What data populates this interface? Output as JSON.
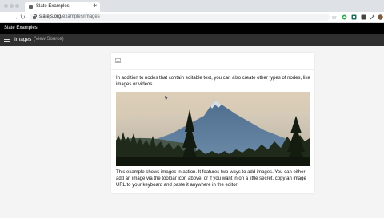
{
  "browser": {
    "tab_title": "Slate Examples",
    "tab_close": "×",
    "new_tab": "+",
    "url_host": "slatejs.org",
    "url_path": "/examples/images",
    "back": "←",
    "forward": "→",
    "reload": "↻",
    "bookmark_star": "☆",
    "extensions": [
      "extension-icon",
      "extension-icon",
      "extension-icon",
      "eyedropper-icon",
      "puzzle-icon",
      "avatar-icon"
    ]
  },
  "site": {
    "title": "Slate Examples",
    "example_title": "Images",
    "view_source": "(View Source)"
  },
  "editor": {
    "toolbar_button_icon": "image-icon",
    "paragraph1": "In addition to nodes that contain editable text, you can also create other types of nodes, like images or videos.",
    "image_alt": "mountain landscape with pine trees",
    "paragraph2": "This example shows images in action. It features two ways to add images. You can either add an image via the toolbar icon above, or if you want in on a little secret, copy an image URL to your keyboard and paste it anywhere in the editor!"
  },
  "colors": {
    "site_header": "#000000",
    "nav_bar": "#2f2f2f",
    "page_bg": "#f4f4f4",
    "sky": "#d8cfbf",
    "mountain": "#5d7d9e",
    "forest": "#1b2315"
  }
}
